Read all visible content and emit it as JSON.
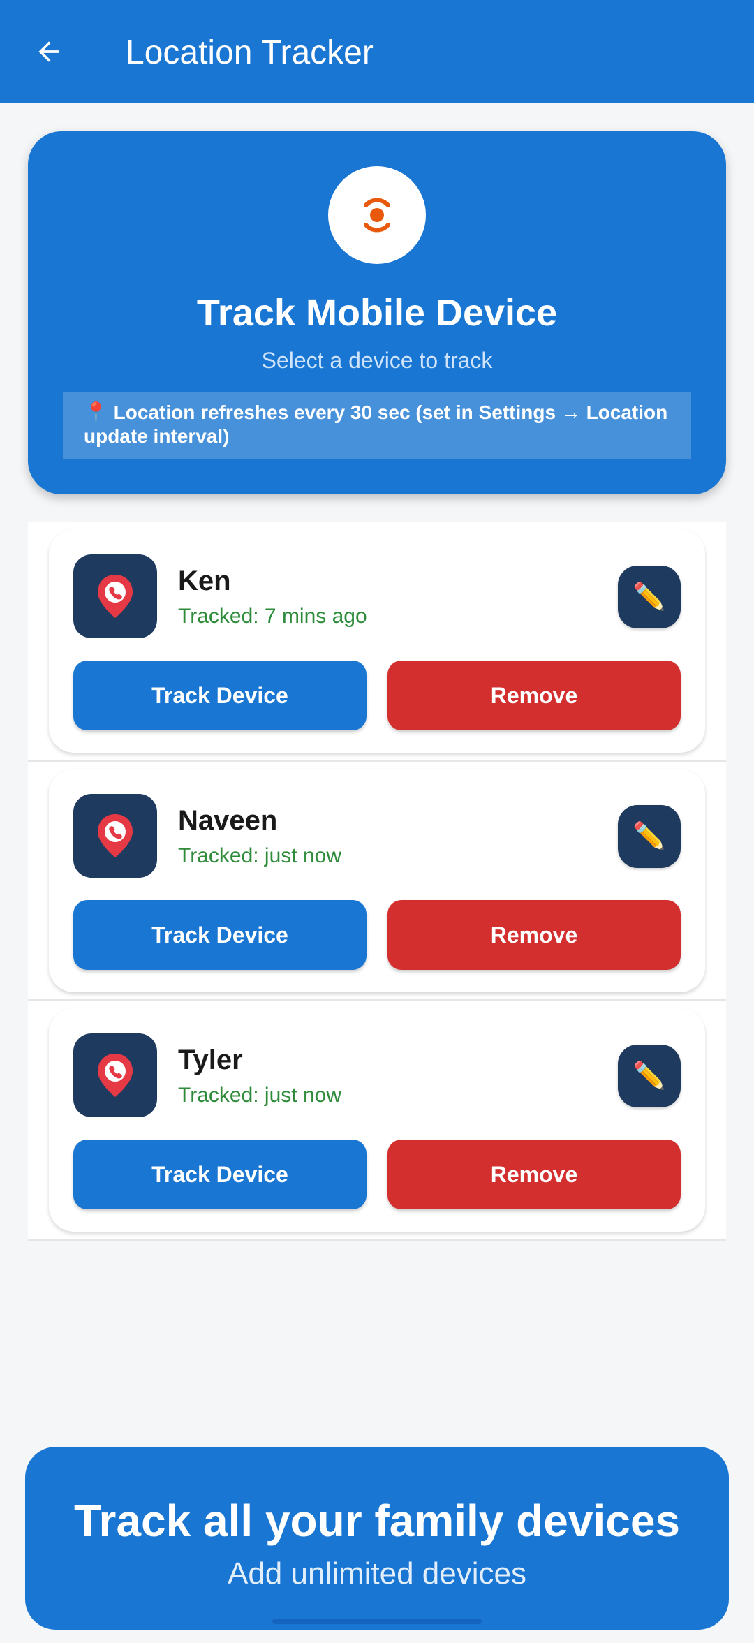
{
  "appbar": {
    "title": "Location Tracker",
    "back_icon": "arrow-left-icon"
  },
  "hero": {
    "icon": "target-tracking-icon",
    "title": "Track Mobile Device",
    "subtitle": "Select a device to track",
    "note": "📍 Location refreshes every 30 sec  (set in Settings → Location update interval)"
  },
  "devices": [
    {
      "name": "Ken",
      "status": "Tracked: 7 mins ago",
      "track_label": "Track Device",
      "remove_label": "Remove",
      "edit_icon": "✏️"
    },
    {
      "name": "Naveen",
      "status": "Tracked: just now",
      "track_label": "Track Device",
      "remove_label": "Remove",
      "edit_icon": "✏️"
    },
    {
      "name": "Tyler",
      "status": "Tracked: just now",
      "track_label": "Track Device",
      "remove_label": "Remove",
      "edit_icon": "✏️"
    }
  ],
  "promo": {
    "title": "Track all your family devices",
    "subtitle": "Add unlimited devices"
  },
  "colors": {
    "primary": "#1976d2",
    "danger": "#d32f2f",
    "icon_tile": "#1f3a5f",
    "status_green": "#2e8b3a",
    "target_orange": "#e8590c",
    "pin_red": "#e53945"
  }
}
